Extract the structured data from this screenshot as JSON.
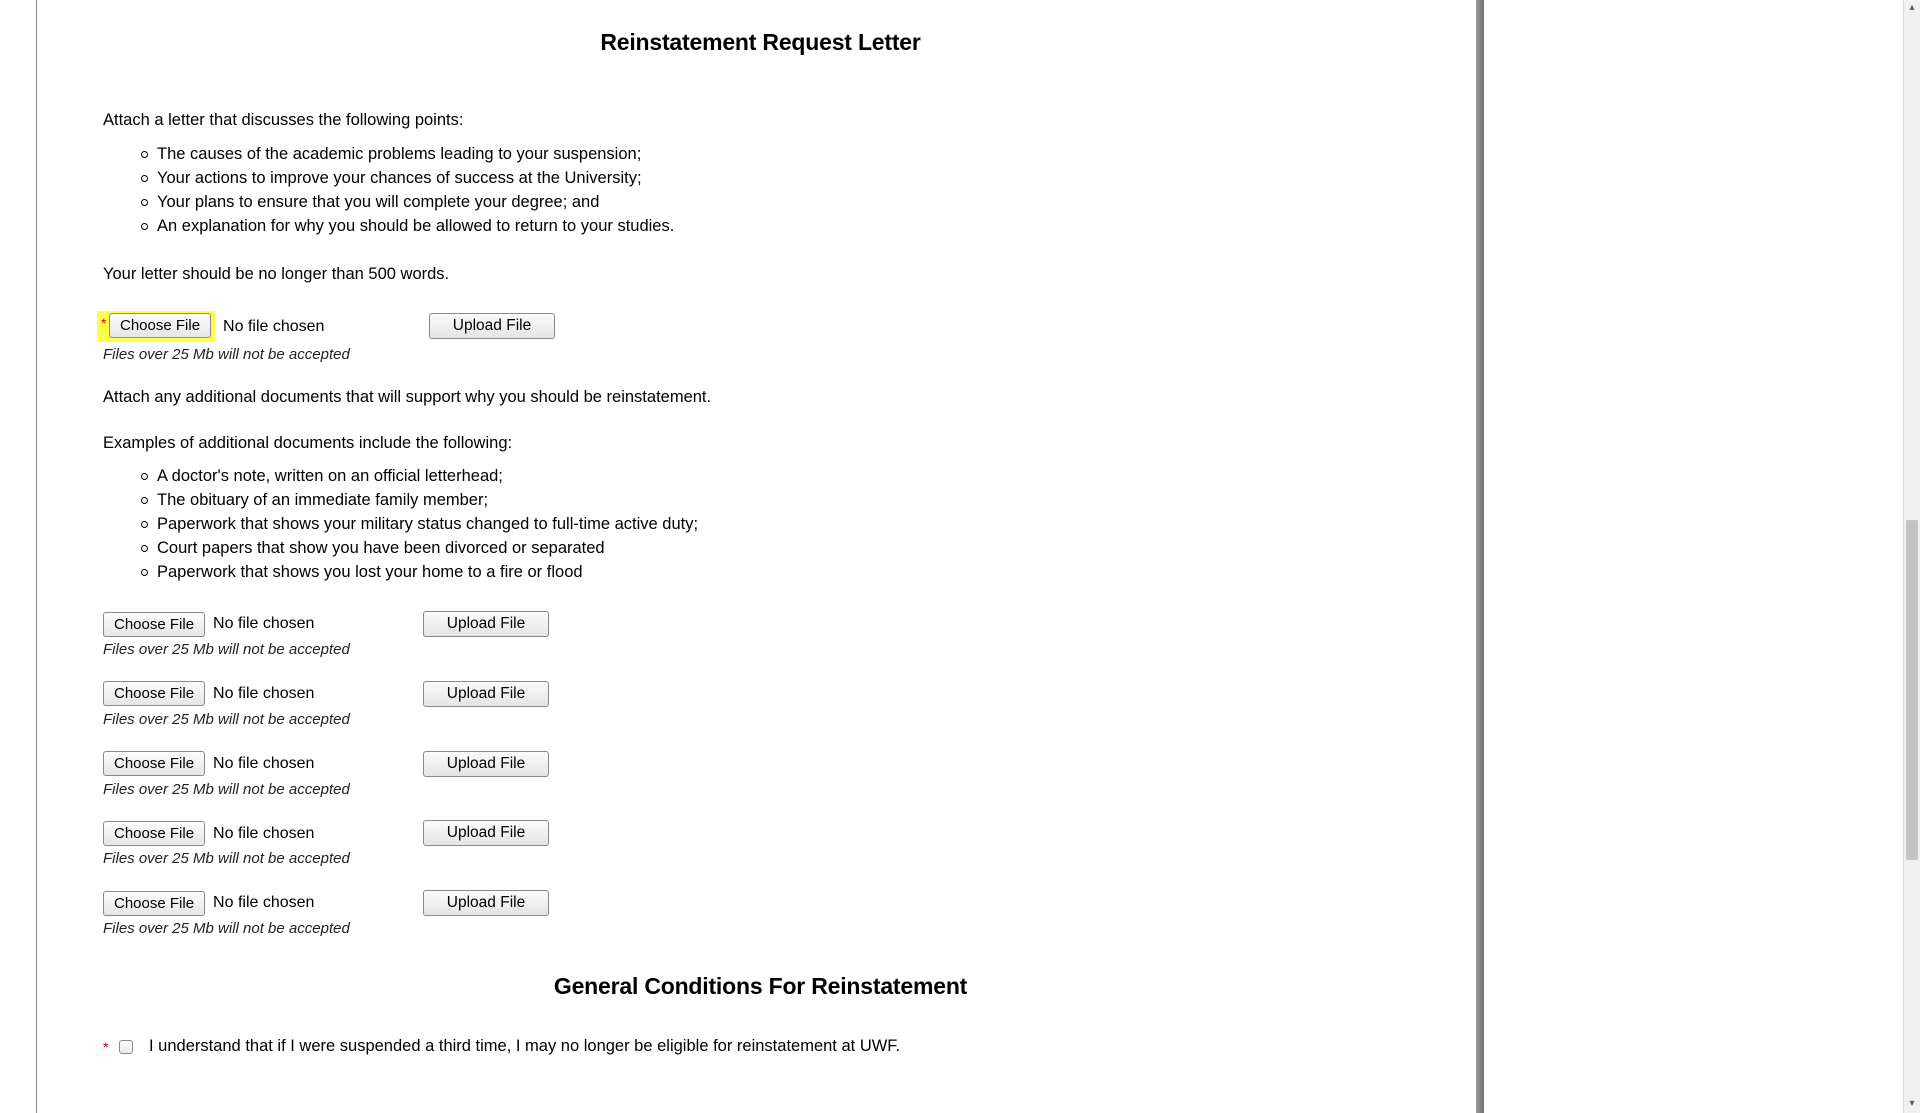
{
  "section1": {
    "title": "Reinstatement Request Letter",
    "intro": "Attach a letter that discusses the following points:",
    "points": [
      "The causes of the academic problems leading to your suspension;",
      "Your actions to improve your chances of success at the University;",
      "Your plans to ensure that you will complete your degree; and",
      "An explanation for why you should be allowed to return to your studies."
    ],
    "lengthNote": "Your letter should be no longer than 500 words."
  },
  "mainUpload": {
    "requiredMark": "*",
    "chooseLabel": "Choose File",
    "noFile": "No file chosen",
    "uploadLabel": "Upload File",
    "sizeNote": "Files over 25 Mb will not be accepted"
  },
  "additional": {
    "intro": "Attach any additional documents that will support why you should be reinstatement.",
    "examplesIntro": "Examples of additional documents include the following:",
    "examples": [
      "A doctor's note, written on an official letterhead;",
      "The obituary of an immediate family member;",
      "Paperwork that shows your military status changed to full-time active duty;",
      "Court papers that show you have been divorced or separated",
      "Paperwork that shows you lost your home to a fire or flood"
    ],
    "rows": [
      {
        "chooseLabel": "Choose File",
        "noFile": "No file chosen",
        "uploadLabel": "Upload File",
        "sizeNote": "Files over 25 Mb will not be accepted"
      },
      {
        "chooseLabel": "Choose File",
        "noFile": "No file chosen",
        "uploadLabel": "Upload File",
        "sizeNote": "Files over 25 Mb will not be accepted"
      },
      {
        "chooseLabel": "Choose File",
        "noFile": "No file chosen",
        "uploadLabel": "Upload File",
        "sizeNote": "Files over 25 Mb will not be accepted"
      },
      {
        "chooseLabel": "Choose File",
        "noFile": "No file chosen",
        "uploadLabel": "Upload File",
        "sizeNote": "Files over 25 Mb will not be accepted"
      },
      {
        "chooseLabel": "Choose File",
        "noFile": "No file chosen",
        "uploadLabel": "Upload File",
        "sizeNote": "Files over 25 Mb will not be accepted"
      }
    ]
  },
  "section2": {
    "title": "General Conditions For Reinstatement",
    "requiredMark": "*",
    "checkboxText": "I understand that if I were suspended a third time, I may no longer be eligible for reinstatement at UWF."
  },
  "scrollbar": {
    "upGlyph": "▴",
    "downGlyph": "▾"
  }
}
